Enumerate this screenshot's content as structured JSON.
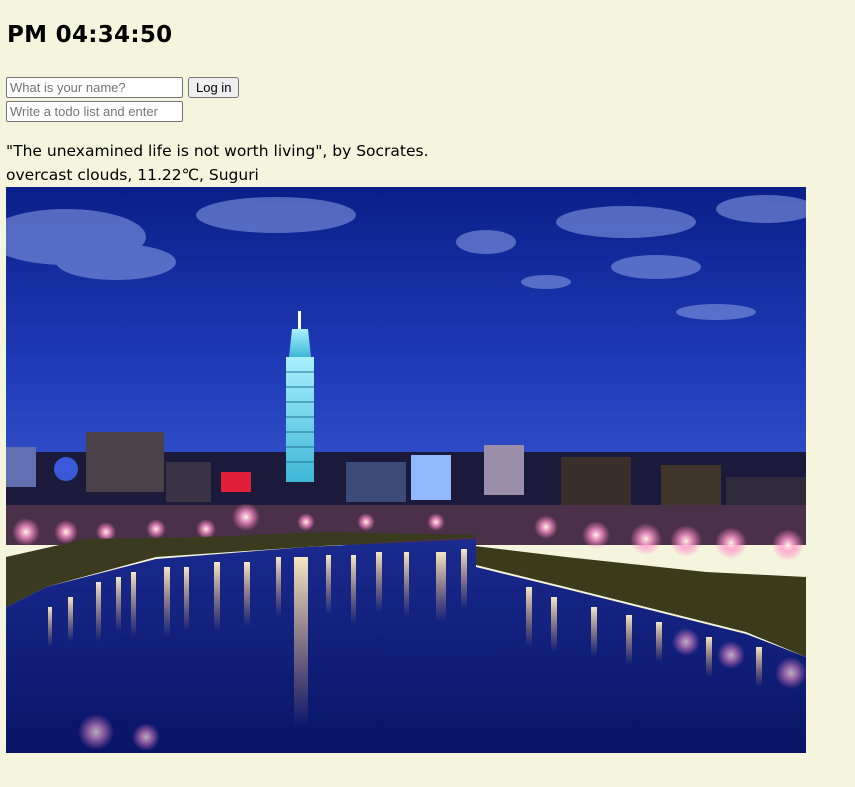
{
  "clock": {
    "text": "PM 04:34:50"
  },
  "login": {
    "name_placeholder": "What is your name?",
    "button_label": "Log in"
  },
  "todo": {
    "placeholder": "Write a todo list and enter"
  },
  "quote": {
    "text": "\"The unexamined life is not worth living\", by Socrates."
  },
  "weather": {
    "text": "overcast clouds, 11.22℃, Suguri"
  },
  "background": {
    "subject": "night-city-skyline-river-photo"
  },
  "colors": {
    "page_background": "#f5f4dd",
    "sky_top": "#0b1f8a",
    "sky_bottom": "#2a46c4",
    "river": "#0c1a6e"
  }
}
